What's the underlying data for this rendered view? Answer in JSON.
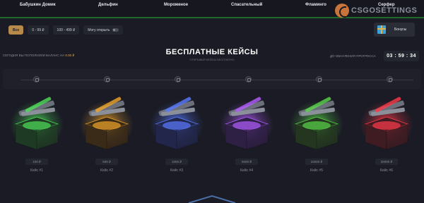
{
  "nav": {
    "items": [
      "Бабушкин Домик",
      "Дельфин",
      "Мороженое",
      "Спасательный",
      "Фламинго",
      "Серфер"
    ]
  },
  "logo": {
    "text": "CSGOSETTINGS"
  },
  "filters": {
    "items": [
      {
        "label": "Все",
        "active": true
      },
      {
        "label": "0 - 99 ₽",
        "active": false
      },
      {
        "label": "100 - 499 ₽",
        "active": false
      }
    ],
    "toggle_label": "Могу открыть"
  },
  "bonus": {
    "label": "Бонусы",
    "icon": "gift-icon"
  },
  "header": {
    "balance_note_prefix": "СЕГОДНЯ ВЫ ПОПОЛНИЛИ БАЛАНС НА",
    "balance_amount": "0.00 ₽",
    "title": "БЕСПЛАТНЫЕ КЕЙСЫ",
    "subtitle": "ОТКРЫВАЙ КЕЙСЫ БЕСПЛАТНО",
    "timer_label": "ДО ОБНУЛЕНИЯ ПРОГРЕССА",
    "timer": "03 : 59 : 34"
  },
  "progress": {
    "locks": 6,
    "icon": "lock-icon"
  },
  "cases": [
    {
      "name": "Кейс #1",
      "price": "100 ₽",
      "glow": "#4fe05a",
      "box": "#1f3a24"
    },
    {
      "name": "Кейс #2",
      "price": "500 ₽",
      "glow": "#f0a62a",
      "box": "#3a2a18"
    },
    {
      "name": "Кейс #3",
      "price": "1000 ₽",
      "glow": "#5a7bff",
      "box": "#22264a"
    },
    {
      "name": "Кейс #4",
      "price": "5000 ₽",
      "glow": "#b45cff",
      "box": "#2e1f44"
    },
    {
      "name": "Кейс #5",
      "price": "10000 ₽",
      "glow": "#5ad64a",
      "box": "#24361f"
    },
    {
      "name": "Кейс #6",
      "price": "30000 ₽",
      "glow": "#ff3a4a",
      "box": "#3e1c22"
    }
  ]
}
